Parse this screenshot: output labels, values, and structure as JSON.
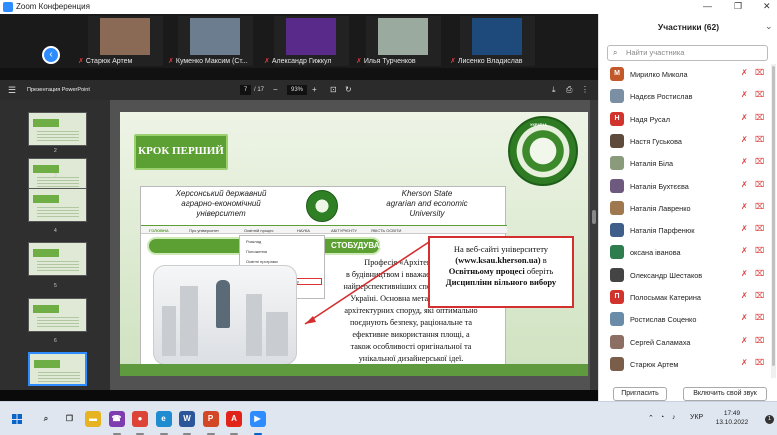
{
  "window": {
    "title": "Zoom Конференция"
  },
  "gallery": {
    "tiles": [
      {
        "name": "Старюк Артем",
        "color": "#8a6a55"
      },
      {
        "name": "Куменко Максим (Ст...",
        "color": "#6b7d8e"
      },
      {
        "name": "Александр Гижкул",
        "color": "#5a2a8a"
      },
      {
        "name": "Илья Турченков",
        "color": "#9aaa9e"
      },
      {
        "name": "Лисенко Владислав",
        "color": "#1d4a7a"
      }
    ]
  },
  "ppt": {
    "doc_title": "Презентация PowerPoint",
    "page_current": "7",
    "page_total": "/ 17",
    "zoom": "93%",
    "thumbs": [
      {
        "num": "2"
      },
      {
        "num": "3"
      },
      {
        "num": "4"
      },
      {
        "num": "5"
      },
      {
        "num": "6"
      },
      {
        "num": "7"
      }
    ]
  },
  "slide": {
    "step_button": "КРОК ПЕРШИЙ",
    "logo_text": "УКРАЇНА",
    "site": {
      "uk_lines": [
        "Херсонський державний",
        "аграрно-економічний",
        "університет"
      ],
      "en_lines": [
        "Kherson State",
        "agrarian and economic",
        "University"
      ],
      "nav": [
        "ГОЛОВНА",
        "Про університет",
        "Освітній процес",
        "НАУКА",
        "АБІТУРІЄНТУ",
        "ЯКІСТЬ ОСВІТИ"
      ],
      "dropdown": [
        "Розклад",
        "Положення",
        "Освітні програми",
        "Бази практик",
        "Дисципліни вільного вибору",
        "Неформальна освіта"
      ],
      "banner_left": "А",
      "banner_right": "СТОБУДУВАННЯ",
      "body_lines": [
        "Професія «Архітектор» т...",
        "в будівництвом і вважається однією з",
        "найперспективніших спеціальностей в",
        "Україні. Основна мета – створення",
        "архітектурних споруд, які оптимально",
        "поєднують безпеку, раціональне та",
        "ефективне використання площі, а",
        "також особливості оригінальної та",
        "унікальної дизайнерської ідеї."
      ],
      "dots": "• • • • • • • • • • • • • • • • • • • •"
    },
    "callout": {
      "line1": "На веб-сайті університету",
      "line2": "(www.ksau.kherson.ua)",
      "line2_suffix": " в",
      "line3_bold": "Освітньому процесі",
      "line3_suffix": " оберіть",
      "line4": "Дисципліни вільного вибору"
    }
  },
  "participants": {
    "title": "Участники (62)",
    "search_placeholder": "Найти участника",
    "list": [
      {
        "initial": "М",
        "name": "Мирилко Микола",
        "color": "#c1592a"
      },
      {
        "initial": "",
        "name": "Надєєв Ростислав",
        "color": "#7a8fa3"
      },
      {
        "initial": "Н",
        "name": "Надя Русал",
        "color": "#d0342c"
      },
      {
        "initial": "",
        "name": "Настя Гуськова",
        "color": "#5e4b3c"
      },
      {
        "initial": "",
        "name": "Наталія Біла",
        "color": "#8a9b7c"
      },
      {
        "initial": "",
        "name": "Наталія Бухтєєва",
        "color": "#6d5a7e"
      },
      {
        "initial": "",
        "name": "Наталія Лавренко",
        "color": "#a07850"
      },
      {
        "initial": "",
        "name": "Наталія Парфенюк",
        "color": "#3f5f8a"
      },
      {
        "initial": "",
        "name": "оксана іванова",
        "color": "#2e7d4f"
      },
      {
        "initial": "",
        "name": "Олександр Шестаков",
        "color": "#444444"
      },
      {
        "initial": "П",
        "name": "Полосьмак Катерина",
        "color": "#d0342c"
      },
      {
        "initial": "",
        "name": "Ростислав Соценко",
        "color": "#6a8ca8"
      },
      {
        "initial": "",
        "name": "Сергей Саламаха",
        "color": "#8d6e63"
      },
      {
        "initial": "",
        "name": "Старюк Артем",
        "color": "#7b5e4a"
      }
    ],
    "invite_button": "Пригласить",
    "unmute_button": "Включить свой звук"
  },
  "taskbar": {
    "language": "УКР",
    "time": "17:49",
    "date": "13.10.2022",
    "notification_count": "1",
    "apps": [
      {
        "icon": "search-icon",
        "glyph": "⌕",
        "color": "#dfe6ef"
      },
      {
        "icon": "task-view-icon",
        "glyph": "❐",
        "color": "#dfe6ef"
      },
      {
        "icon": "explorer-icon",
        "glyph": "▬",
        "color": "#e6b422"
      },
      {
        "icon": "viber-icon",
        "glyph": "☎",
        "color": "#7d3daf"
      },
      {
        "icon": "chrome-icon",
        "glyph": "●",
        "color": "#db4437"
      },
      {
        "icon": "edge-icon",
        "glyph": "e",
        "color": "#1f8bd1"
      },
      {
        "icon": "word-icon",
        "glyph": "W",
        "color": "#2b579a"
      },
      {
        "icon": "powerpoint-icon",
        "glyph": "P",
        "color": "#d24726"
      },
      {
        "icon": "acrobat-icon",
        "glyph": "A",
        "color": "#e2231a"
      },
      {
        "icon": "zoom-icon",
        "glyph": "▶",
        "color": "#2d8cff"
      }
    ]
  }
}
